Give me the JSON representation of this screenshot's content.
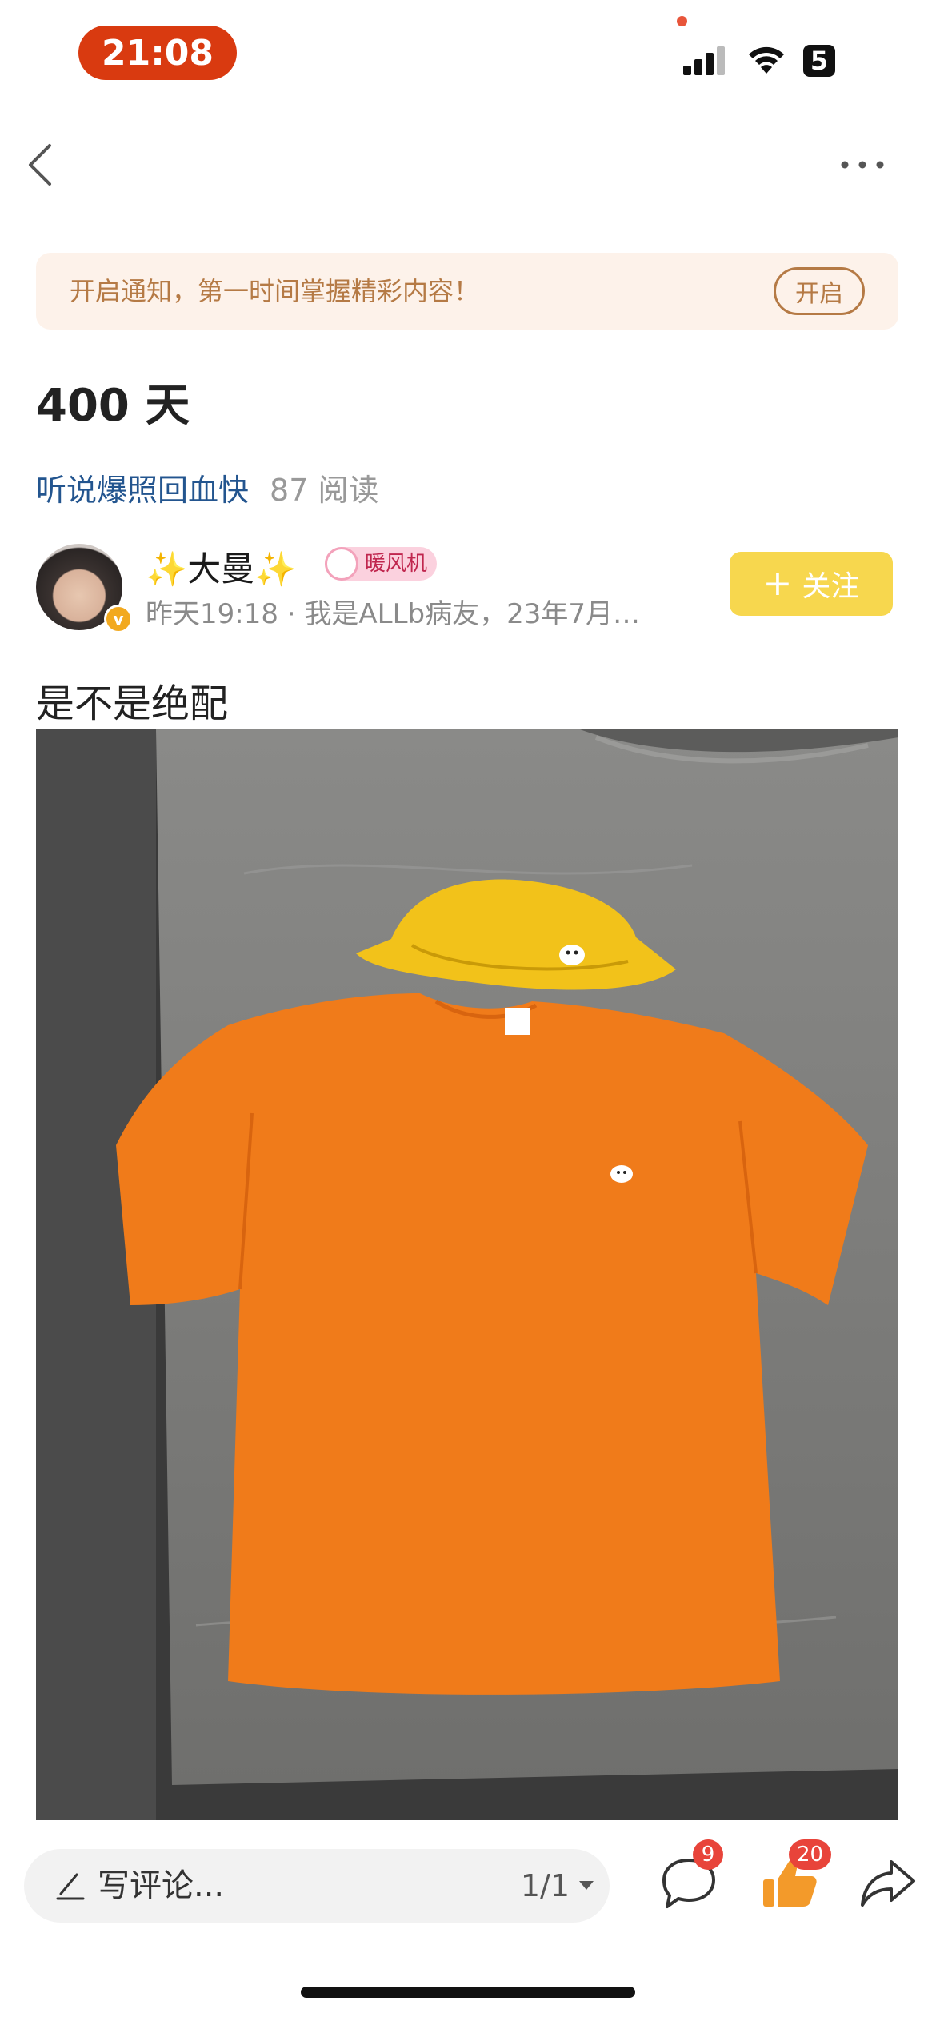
{
  "status_bar": {
    "time": "21:08",
    "battery": "5"
  },
  "notification": {
    "text": "开启通知，第一时间掌握精彩内容！",
    "button_label": "开启"
  },
  "post": {
    "title": "400 天",
    "topic": "听说爆照回血快",
    "read_count": "87 阅读",
    "body": "是不是绝配"
  },
  "author": {
    "name": "✨大曼✨",
    "badge": "暖风机",
    "meta": "昨天19:18 · 我是ALLb病友，23年7月…",
    "verify_mark": "v",
    "follow_plus": "+",
    "follow_label": "关注"
  },
  "bottom_bar": {
    "comment_placeholder": "写评论...",
    "page_indicator": "1/1",
    "comment_count": "9",
    "like_count": "20"
  },
  "colors": {
    "status_pill": "#d93a10",
    "notice_bg": "#fdf2ea",
    "notice_text": "#b57a45",
    "topic_link": "#23558f",
    "follow_button": "#f7d74e",
    "like_orange": "#f39a2a",
    "badge_red": "#e8443a"
  },
  "icons": {
    "back": "chevron-left-icon",
    "more": "more-dots-icon",
    "edit": "pen-icon",
    "comment": "comment-bubble-icon",
    "like": "thumbs-up-icon",
    "share": "share-arrow-icon"
  }
}
